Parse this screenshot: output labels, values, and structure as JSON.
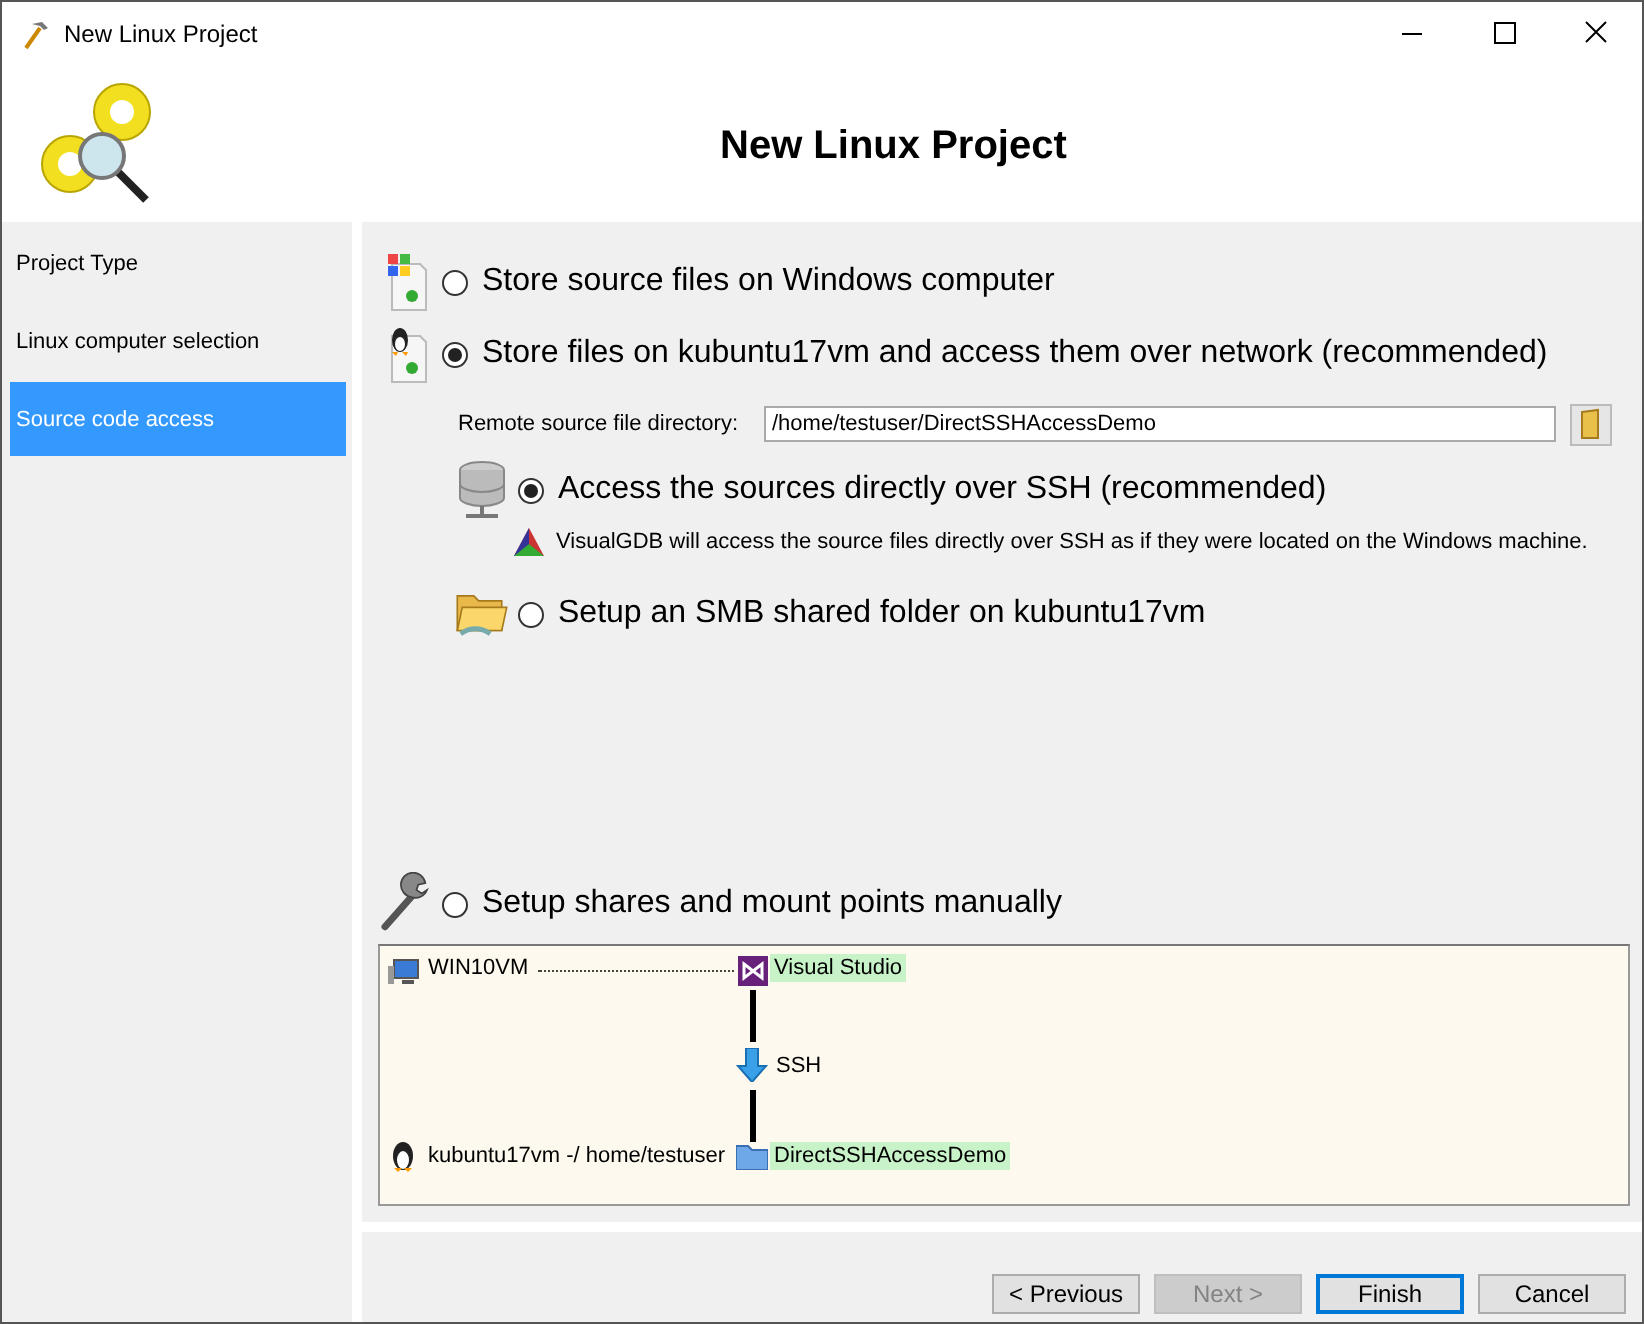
{
  "window": {
    "title": "New Linux Project"
  },
  "header": {
    "title": "New Linux Project"
  },
  "sidebar": {
    "items": [
      {
        "label": "Project Type",
        "selected": false
      },
      {
        "label": "Linux computer selection",
        "selected": false
      },
      {
        "label": "Source code access",
        "selected": true
      }
    ]
  },
  "options": [
    {
      "label": "Store source files on Windows computer",
      "selected": false,
      "kind": "windows"
    },
    {
      "label": "Store files on kubuntu17vm and access them over network (recommended)",
      "selected": true,
      "kind": "linux",
      "directory": {
        "label": "Remote source file directory:",
        "value": "/home/testuser/DirectSSHAccessDemo"
      },
      "children": [
        {
          "label": "Access the sources directly over SSH (recommended)",
          "selected": true,
          "kind": "server",
          "note": "VisualGDB will access the source files directly over SSH as if they were located on the Windows machine."
        },
        {
          "label": "Setup an SMB shared folder on kubuntu17vm",
          "selected": false,
          "kind": "folder"
        }
      ]
    },
    {
      "label": "Setup shares and mount points manually",
      "selected": false,
      "kind": "wrench"
    }
  ],
  "diagram": {
    "local_host": "WIN10VM",
    "local_app": "Visual Studio",
    "link": "SSH",
    "remote_host": "kubuntu17vm -/ home/testuser",
    "remote_dir": "DirectSSHAccessDemo"
  },
  "buttons": [
    {
      "label": "< Previous",
      "disabled": false,
      "focused": false
    },
    {
      "label": "Next >",
      "disabled": true,
      "focused": false
    },
    {
      "label": "Finish",
      "disabled": false,
      "focused": true
    },
    {
      "label": "Cancel",
      "disabled": false,
      "focused": false
    }
  ]
}
